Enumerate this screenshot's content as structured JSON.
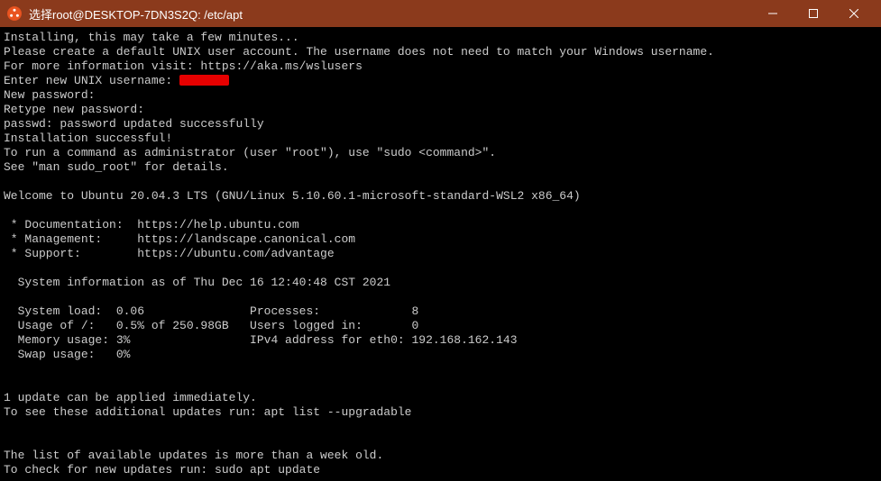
{
  "titlebar": {
    "title": "选择root@DESKTOP-7DN3S2Q: /etc/apt"
  },
  "terminal": {
    "lines": [
      "Installing, this may take a few minutes...",
      "Please create a default UNIX user account. The username does not need to match your Windows username.",
      "For more information visit: https://aka.ms/wslusers",
      "Enter new UNIX username: ",
      "New password:",
      "Retype new password:",
      "passwd: password updated successfully",
      "Installation successful!",
      "To run a command as administrator (user \"root\"), use \"sudo <command>\".",
      "See \"man sudo_root\" for details.",
      "",
      "Welcome to Ubuntu 20.04.3 LTS (GNU/Linux 5.10.60.1-microsoft-standard-WSL2 x86_64)",
      "",
      " * Documentation:  https://help.ubuntu.com",
      " * Management:     https://landscape.canonical.com",
      " * Support:        https://ubuntu.com/advantage",
      "",
      "  System information as of Thu Dec 16 12:40:48 CST 2021",
      "",
      "  System load:  0.06               Processes:             8",
      "  Usage of /:   0.5% of 250.98GB   Users logged in:       0",
      "  Memory usage: 3%                 IPv4 address for eth0: 192.168.162.143",
      "  Swap usage:   0%",
      "",
      "",
      "1 update can be applied immediately.",
      "To see these additional updates run: apt list --upgradable",
      "",
      "",
      "The list of available updates is more than a week old.",
      "To check for new updates run: sudo apt update"
    ],
    "redacted_line_index": 3
  }
}
